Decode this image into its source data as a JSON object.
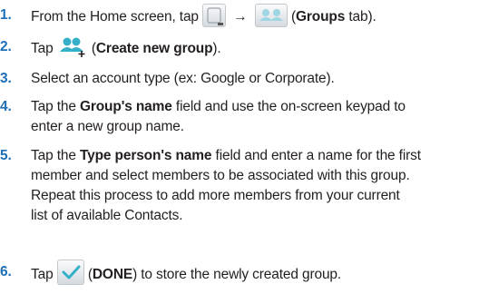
{
  "steps": [
    {
      "num": "1.",
      "parts": {
        "a": "From the Home screen, tap ",
        "arrow": "→",
        "c": " (",
        "groups_tab": "Groups",
        "d": " tab)."
      }
    },
    {
      "num": "2.",
      "parts": {
        "a": "Tap ",
        "b": " (",
        "create_group": "Create new group",
        "c": ")."
      }
    },
    {
      "num": "3.",
      "lines": [
        "Select an account type (ex: Google or Corporate)."
      ]
    },
    {
      "num": "4.",
      "parts": {
        "a": "Tap the ",
        "group_name": "Group's name",
        "b": " field and use the on-screen keypad to",
        "line2": "enter a new group name."
      }
    },
    {
      "num": "5.",
      "parts": {
        "a": "Tap the ",
        "type_person": "Type person's name",
        "b": " field and enter a name for the first",
        "line2": "member and select members to be associated with this group.",
        "line3": "Repeat this process to add more members from your current",
        "line4": "list of available Contacts."
      }
    },
    {
      "num": "6.",
      "parts": {
        "a": "Tap ",
        "b": " (",
        "done": "DONE",
        "c": ") to store the newly created group."
      }
    }
  ],
  "icons": {
    "contacts": "contacts-app-icon",
    "groups_tab": "groups-tab-icon",
    "create_group": "create-group-icon",
    "done": "done-checkmark-icon"
  },
  "colors": {
    "step_number": "#1d6fb8",
    "icon_teal": "#35b0c8",
    "text": "#231f20"
  }
}
